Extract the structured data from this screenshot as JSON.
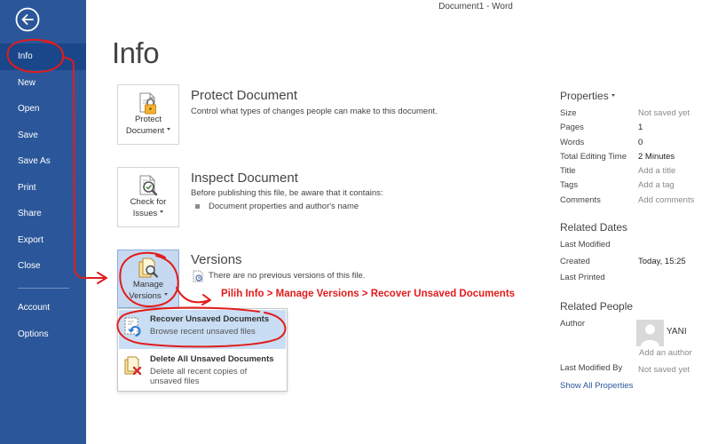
{
  "window": {
    "title": "Document1 - Word"
  },
  "colors": {
    "sidebar": "#2B579A",
    "sidebar_selected": "#19478A",
    "selection": "#C6D9F1",
    "annotation": "#E31B1B",
    "link": "#2B579A",
    "muted": "#8A8A8A"
  },
  "sidebar": {
    "back_icon": "back-arrow-icon",
    "items": [
      {
        "label": "Info",
        "selected": true
      },
      {
        "label": "New"
      },
      {
        "label": "Open"
      },
      {
        "label": "Save"
      },
      {
        "label": "Save As"
      },
      {
        "label": "Print"
      },
      {
        "label": "Share"
      },
      {
        "label": "Export"
      },
      {
        "label": "Close"
      }
    ],
    "footer_items": [
      {
        "label": "Account"
      },
      {
        "label": "Options"
      }
    ]
  },
  "main": {
    "title": "Info",
    "protect": {
      "button": {
        "line1": "Protect",
        "line2": "Document",
        "icon": "lock-icon"
      },
      "heading": "Protect Document",
      "description": "Control what types of changes people can make to this document."
    },
    "inspect": {
      "button": {
        "line1": "Check for",
        "line2": "Issues",
        "icon": "inspect-document-icon"
      },
      "heading": "Inspect Document",
      "description": "Before publishing this file, be aware that it contains:",
      "bullets": [
        "Document properties and author's name"
      ]
    },
    "versions": {
      "button": {
        "line1": "Manage",
        "line2": "Versions",
        "icon": "manage-versions-icon"
      },
      "heading": "Versions",
      "status_icon": "versions-icon",
      "status": "There are no previous versions of this file."
    }
  },
  "versions_menu": {
    "items": [
      {
        "title": "Recover Unsaved Documents",
        "description": "Browse recent unsaved files",
        "icon": "recover-document-icon",
        "highlighted": true
      },
      {
        "title": "Delete All Unsaved Documents",
        "description": "Delete all recent copies of unsaved files",
        "icon": "delete-documents-icon"
      }
    ]
  },
  "annotation": {
    "text": "Pilih Info > Manage Versions > Recover Unsaved Documents"
  },
  "properties": {
    "heading": "Properties",
    "rows": [
      {
        "label": "Size",
        "value": "Not saved yet"
      },
      {
        "label": "Pages",
        "value": "1"
      },
      {
        "label": "Words",
        "value": "0"
      },
      {
        "label": "Total Editing Time",
        "value": "2 Minutes"
      },
      {
        "label": "Title",
        "value": "Add a title"
      },
      {
        "label": "Tags",
        "value": "Add a tag"
      },
      {
        "label": "Comments",
        "value": "Add comments"
      }
    ]
  },
  "related_dates": {
    "heading": "Related Dates",
    "rows": [
      {
        "label": "Last Modified",
        "value": ""
      },
      {
        "label": "Created",
        "value": "Today, 15:25"
      },
      {
        "label": "Last Printed",
        "value": ""
      }
    ]
  },
  "related_people": {
    "heading": "Related People",
    "author_label": "Author",
    "author_name": "YANI",
    "avatar_icon": "person-placeholder-icon",
    "add_author": "Add an author",
    "last_modified_by_label": "Last Modified By",
    "last_modified_by_value": "Not saved yet"
  },
  "show_all_properties": "Show All Properties"
}
